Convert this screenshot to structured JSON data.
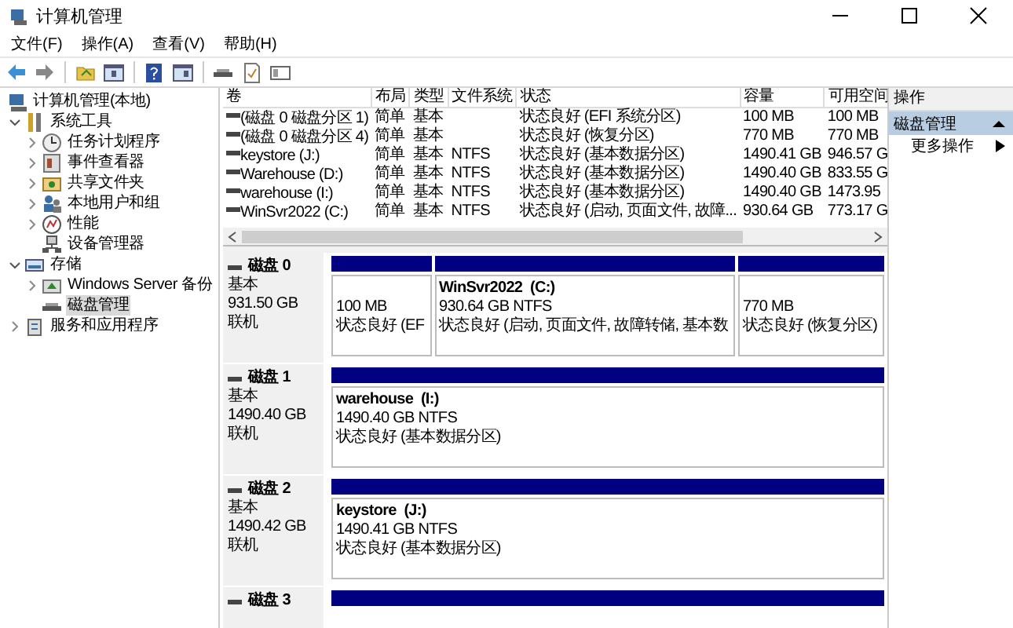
{
  "window": {
    "title": "计算机管理"
  },
  "menu": [
    "文件(F)",
    "操作(A)",
    "查看(V)",
    "帮助(H)"
  ],
  "tree": [
    {
      "label": "计算机管理(本地)",
      "selected": false,
      "children": [
        {
          "label": "系统工具",
          "expanded": true,
          "selected": false,
          "children": [
            {
              "label": "任务计划程序",
              "expanded": false,
              "selected": false
            },
            {
              "label": "事件查看器",
              "expanded": false,
              "selected": false
            },
            {
              "label": "共享文件夹",
              "expanded": false,
              "selected": false
            },
            {
              "label": "本地用户和组",
              "expanded": false,
              "selected": false
            },
            {
              "label": "性能",
              "expanded": false,
              "selected": false
            },
            {
              "label": "设备管理器",
              "selected": false
            }
          ]
        },
        {
          "label": "存储",
          "expanded": true,
          "selected": false,
          "children": [
            {
              "label": "Windows Server 备份",
              "expanded": false,
              "selected": false
            },
            {
              "label": "磁盘管理",
              "selected": true
            }
          ]
        },
        {
          "label": "服务和应用程序",
          "expanded": false,
          "selected": false
        }
      ]
    }
  ],
  "volumes": {
    "columns": [
      "卷",
      "布局",
      "类型",
      "文件系统",
      "状态",
      "容量",
      "可用空间"
    ],
    "rows": [
      {
        "cells": [
          "(磁盘 0 磁盘分区 1)",
          "简单",
          "基本",
          "",
          "状态良好 (EFI 系统分区)",
          "100 MB",
          "100 MB"
        ]
      },
      {
        "cells": [
          "(磁盘 0 磁盘分区 4)",
          "简单",
          "基本",
          "",
          "状态良好 (恢复分区)",
          "770 MB",
          "770 MB"
        ]
      },
      {
        "cells": [
          "keystore (J:)",
          "简单",
          "基本",
          "NTFS",
          "状态良好 (基本数据分区)",
          "1490.41 GB",
          "946.57 G"
        ]
      },
      {
        "cells": [
          "Warehouse (D:)",
          "简单",
          "基本",
          "NTFS",
          "状态良好 (基本数据分区)",
          "1490.40 GB",
          "833.55 G"
        ]
      },
      {
        "cells": [
          "warehouse (I:)",
          "简单",
          "基本",
          "NTFS",
          "状态良好 (基本数据分区)",
          "1490.40 GB",
          "1473.95"
        ]
      },
      {
        "cells": [
          "WinSvr2022 (C:)",
          "简单",
          "基本",
          "NTFS",
          "状态良好 (启动, 页面文件, 故障...",
          "930.64 GB",
          "773.17 G"
        ]
      }
    ]
  },
  "disks": [
    {
      "name": "磁盘 0",
      "type": "基本",
      "size": "931.50 GB",
      "status": "联机",
      "partitions": [
        {
          "size": "100 MB",
          "status": "状态良好 (EF"
        },
        {
          "name": "WinSvr2022  (C:)",
          "size": "930.64 GB NTFS",
          "status": "状态良好 (启动, 页面文件, 故障转储, 基本数"
        },
        {
          "size": "770 MB",
          "status": "状态良好 (恢复分区)"
        }
      ]
    },
    {
      "name": "磁盘 1",
      "type": "基本",
      "size": "1490.40 GB",
      "status": "联机",
      "partitions": [
        {
          "name": "warehouse  (I:)",
          "size": "1490.40 GB NTFS",
          "status": "状态良好 (基本数据分区)"
        }
      ]
    },
    {
      "name": "磁盘 2",
      "type": "基本",
      "size": "1490.42 GB",
      "status": "联机",
      "partitions": [
        {
          "name": "keystore  (J:)",
          "size": "1490.41 GB NTFS",
          "status": "状态良好 (基本数据分区)"
        }
      ]
    },
    {
      "name": "磁盘 3"
    }
  ],
  "actions": {
    "title": "操作",
    "sections": [
      {
        "label": "磁盘管理",
        "expanded": true,
        "items": [
          {
            "label": "更多操作"
          }
        ]
      }
    ]
  }
}
